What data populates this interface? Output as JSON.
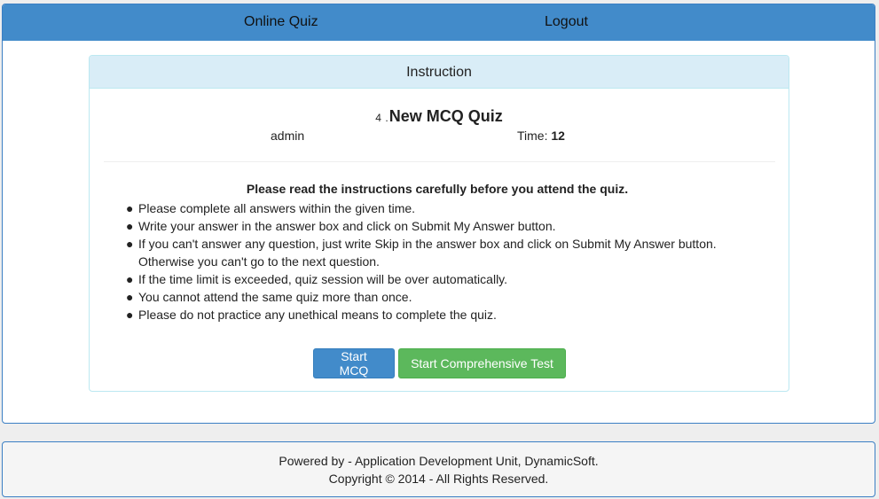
{
  "nav": {
    "brand": "Online Quiz",
    "logout": "Logout"
  },
  "panel": {
    "heading": "Instruction",
    "quiz_number": "4",
    "quiz_sep": ".",
    "quiz_name": "New MCQ Quiz",
    "author": "admin",
    "time_label": "Time:",
    "time_value": "12"
  },
  "instructions": {
    "heading": "Please read the instructions carefully before you attend the quiz.",
    "bullet": "●",
    "items": [
      "Please complete all answers within the given time.",
      "Write your answer in the answer box and click on Submit My Answer button.",
      "If you can't answer any question, just write Skip in the answer box and click on Submit My Answer button. Otherwise you can't go to the next question.",
      "If the time limit is exceeded, quiz session will be over automatically.",
      "You cannot attend the same quiz more than once.",
      "Please do not practice any unethical means to complete the quiz."
    ]
  },
  "buttons": {
    "start_mcq": "Start MCQ",
    "start_comprehensive": "Start Comprehensive Test"
  },
  "footer": {
    "line1": "Powered by - Application Development Unit, DynamicSoft.",
    "line2": "Copyright © 2014 - All Rights Reserved."
  },
  "colors": {
    "navbar": "#428bca",
    "panel_heading": "#d9edf7",
    "primary_button": "#428bca",
    "success_button": "#5cb85c",
    "footer_bg": "#f5f5f5"
  }
}
